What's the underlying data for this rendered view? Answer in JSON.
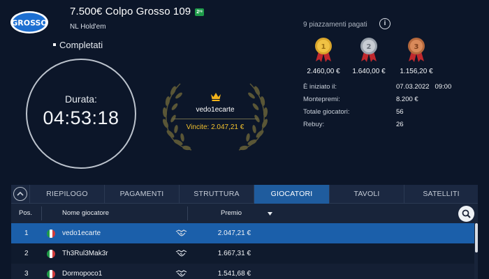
{
  "header": {
    "logo_text": "GROSSO",
    "title": "7.500€ Colpo Grosso 109",
    "title_badge": "2ʳᵉ",
    "subtitle": "NL Hold'em",
    "status": "Completati"
  },
  "timer": {
    "label": "Durata:",
    "value": "04:53:18"
  },
  "winner": {
    "name": "vedo1ecarte",
    "prize_label": "Vincite: 2.047,21 €"
  },
  "payouts": {
    "label": "9 piazzamenti pagati",
    "medals": [
      {
        "rank": "1",
        "value": "2.460,00 €",
        "color": "#d9a52b"
      },
      {
        "rank": "2",
        "value": "1.640,00 €",
        "color": "#9aa2ac"
      },
      {
        "rank": "3",
        "value": "1.156,20 €",
        "color": "#b5683c"
      }
    ]
  },
  "stats": [
    {
      "label": "È iniziato il:",
      "value": "07.03.2022   09:00"
    },
    {
      "label": "Montepremi:",
      "value": "8.200 €"
    },
    {
      "label": "Totale giocatori:",
      "value": "56"
    },
    {
      "label": "Rebuy:",
      "value": "26"
    }
  ],
  "tabs": [
    "RIEPILOGO",
    "PAGAMENTI",
    "STRUTTURA",
    "GIOCATORI",
    "TAVOLI",
    "SATELLITI"
  ],
  "active_tab": "GIOCATORI",
  "table": {
    "headers": {
      "pos": "Pos.",
      "name": "Nome giocatore",
      "prize": "Premio"
    },
    "rows": [
      {
        "pos": "1",
        "name": "vedo1ecarte",
        "prize": "2.047,21 €"
      },
      {
        "pos": "2",
        "name": "Th3Rul3Mak3r",
        "prize": "1.667,31 €"
      },
      {
        "pos": "3",
        "name": "Dormopoco1",
        "prize": "1.541,68 €"
      }
    ]
  },
  "colors": {
    "background": "#0c1629",
    "accent": "#1f5c9e",
    "gold": "#f2c12e"
  }
}
